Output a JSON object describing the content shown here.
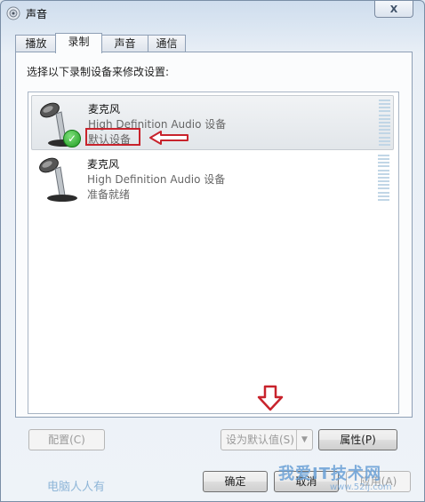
{
  "window": {
    "title": "声音",
    "close_label": "X"
  },
  "tabs": [
    {
      "label": "播放",
      "active": false
    },
    {
      "label": "录制",
      "active": true
    },
    {
      "label": "声音",
      "active": false
    },
    {
      "label": "通信",
      "active": false
    }
  ],
  "panel": {
    "instruction": "选择以下录制设备来修改设置:"
  },
  "devices": [
    {
      "name": "麦克风",
      "description": "High Definition Audio 设备",
      "status": "默认设备",
      "selected": true,
      "default": true
    },
    {
      "name": "麦克风",
      "description": "High Definition Audio 设备",
      "status": "准备就绪",
      "selected": false,
      "default": false
    }
  ],
  "buttons": {
    "configure": "配置(C)",
    "set_default": "设为默认值(S)",
    "properties": "属性(P)",
    "ok": "确定",
    "cancel": "取消",
    "apply": "应用(A)"
  },
  "watermarks": {
    "left": "电脑人人有",
    "right": "我爱IT技术网",
    "right_sub": "www.52ij.com"
  },
  "colors": {
    "highlight_red": "#c8232c",
    "check_green": "#1f9a22"
  },
  "icons": [
    "speaker-icon",
    "microphone-icon",
    "check-icon",
    "left-arrow-icon",
    "down-arrow-icon",
    "dropdown-arrow-icon"
  ]
}
